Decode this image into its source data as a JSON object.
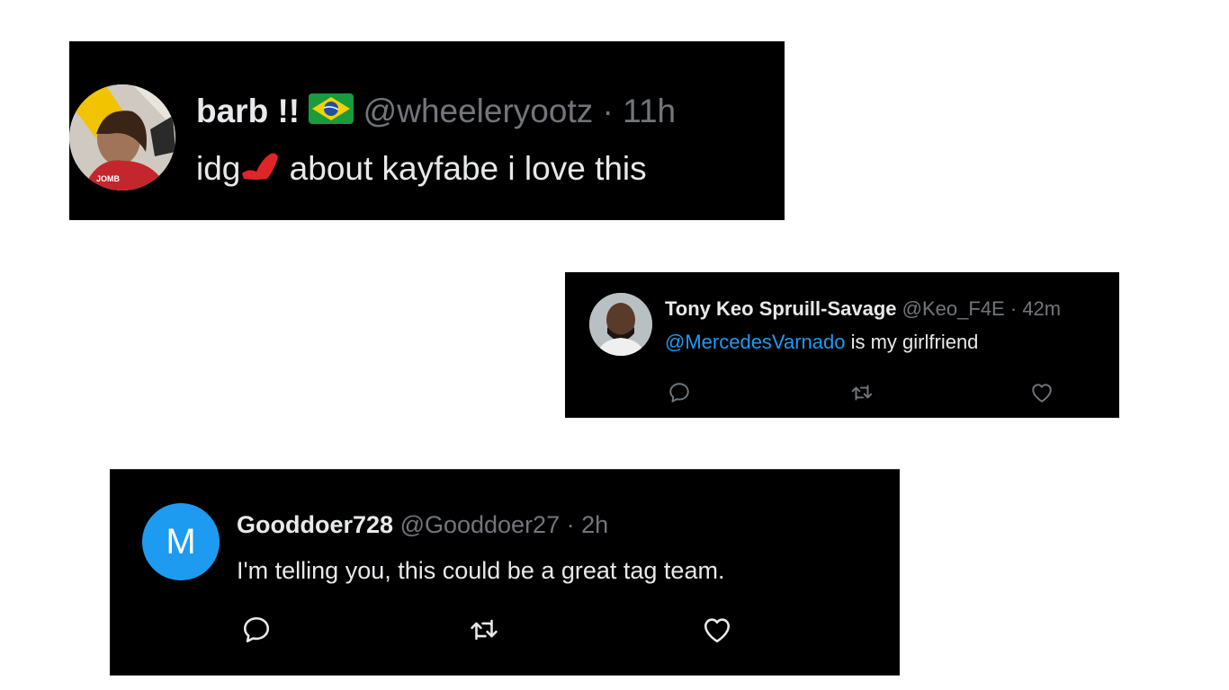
{
  "tweets": [
    {
      "display_name": "barb !!",
      "flag_icon": "brazil-flag-icon",
      "handle": "@wheeleryootz",
      "separator": "·",
      "time": "11h",
      "text_before": "idg",
      "text_after": "about kayfabe i love this"
    },
    {
      "display_name": "Tony Keo Spruill-Savage",
      "handle": "@Keo_F4E",
      "separator": "·",
      "time": "42m",
      "mention": "@MercedesVarnado",
      "text": "is my girlfriend",
      "actions": [
        "reply-icon",
        "retweet-icon",
        "like-icon"
      ]
    },
    {
      "avatar_letter": "M",
      "display_name": "Gooddoer728",
      "handle": "@Gooddoer27",
      "separator": "·",
      "time": "2h",
      "text": "I'm telling you, this could be a great tag team.",
      "actions": [
        "reply-icon",
        "retweet-icon",
        "like-icon"
      ]
    }
  ],
  "colors": {
    "background": "#ffffff",
    "card": "#000000",
    "text": "#e7e9ea",
    "muted": "#71767b",
    "link": "#1d9bf0",
    "avatar_m": "#1d9bf0"
  }
}
